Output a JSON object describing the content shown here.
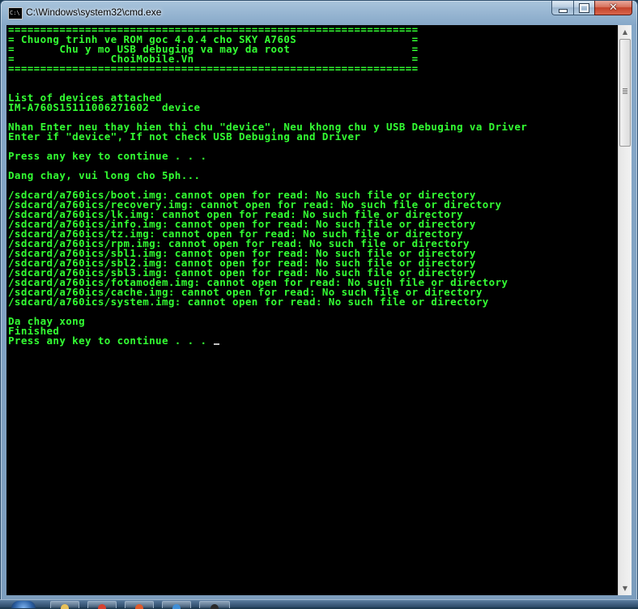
{
  "window": {
    "title": "C:\\Windows\\system32\\cmd.exe",
    "icon_label": "C:\\",
    "controls": {
      "minimize_icon": "minimize-icon",
      "maximize_icon": "maximize-icon",
      "close_icon": "close-icon",
      "close_glyph": "✕"
    }
  },
  "console": {
    "lines": [
      "================================================================",
      "= Chuong trinh ve ROM goc 4.0.4 cho SKY A760S                  =",
      "=       Chu y mo USB debuging va may da root                   =",
      "=               ChoiMobile.Vn                                  =",
      "================================================================",
      "",
      "",
      "List of devices attached",
      "IM-A760S15111006271602  device",
      "",
      "Nhan Enter neu thay hien thi chu \"device\", Neu khong chu y USB Debuging va Driver",
      "Enter if \"device\", If not check USB Debuging and Driver",
      "",
      "Press any key to continue . . .",
      "",
      "Dang chay, vui long cho 5ph...",
      "",
      "/sdcard/a760ics/boot.img: cannot open for read: No such file or directory",
      "/sdcard/a760ics/recovery.img: cannot open for read: No such file or directory",
      "/sdcard/a760ics/lk.img: cannot open for read: No such file or directory",
      "/sdcard/a760ics/info.img: cannot open for read: No such file or directory",
      "/sdcard/a760ics/tz.img: cannot open for read: No such file or directory",
      "/sdcard/a760ics/rpm.img: cannot open for read: No such file or directory",
      "/sdcard/a760ics/sbl1.img: cannot open for read: No such file or directory",
      "/sdcard/a760ics/sbl2.img: cannot open for read: No such file or directory",
      "/sdcard/a760ics/sbl3.img: cannot open for read: No such file or directory",
      "/sdcard/a760ics/fotamodem.img: cannot open for read: No such file or directory",
      "/sdcard/a760ics/cache.img: cannot open for read: No such file or directory",
      "/sdcard/a760ics/system.img: cannot open for read: No such file or directory",
      "",
      "Da chay xong",
      "Finished",
      "Press any key to continue . . . "
    ],
    "text_color": "#33ff33",
    "background": "#000000"
  },
  "scrollbar": {
    "up_arrow": "▲",
    "down_arrow": "▼",
    "thumb_position": 0.0
  },
  "taskbar": {
    "start_icon": "windows-start-icon",
    "items": [
      {
        "icon": "explorer-icon",
        "color": "#e8c15a"
      },
      {
        "icon": "chrome-icon",
        "color": "#d6412f"
      },
      {
        "icon": "media-player-icon",
        "color": "#e05a2a"
      },
      {
        "icon": "globe-icon",
        "color": "#3f8fd8"
      },
      {
        "icon": "cmd-icon",
        "color": "#2a2a2a"
      }
    ]
  }
}
